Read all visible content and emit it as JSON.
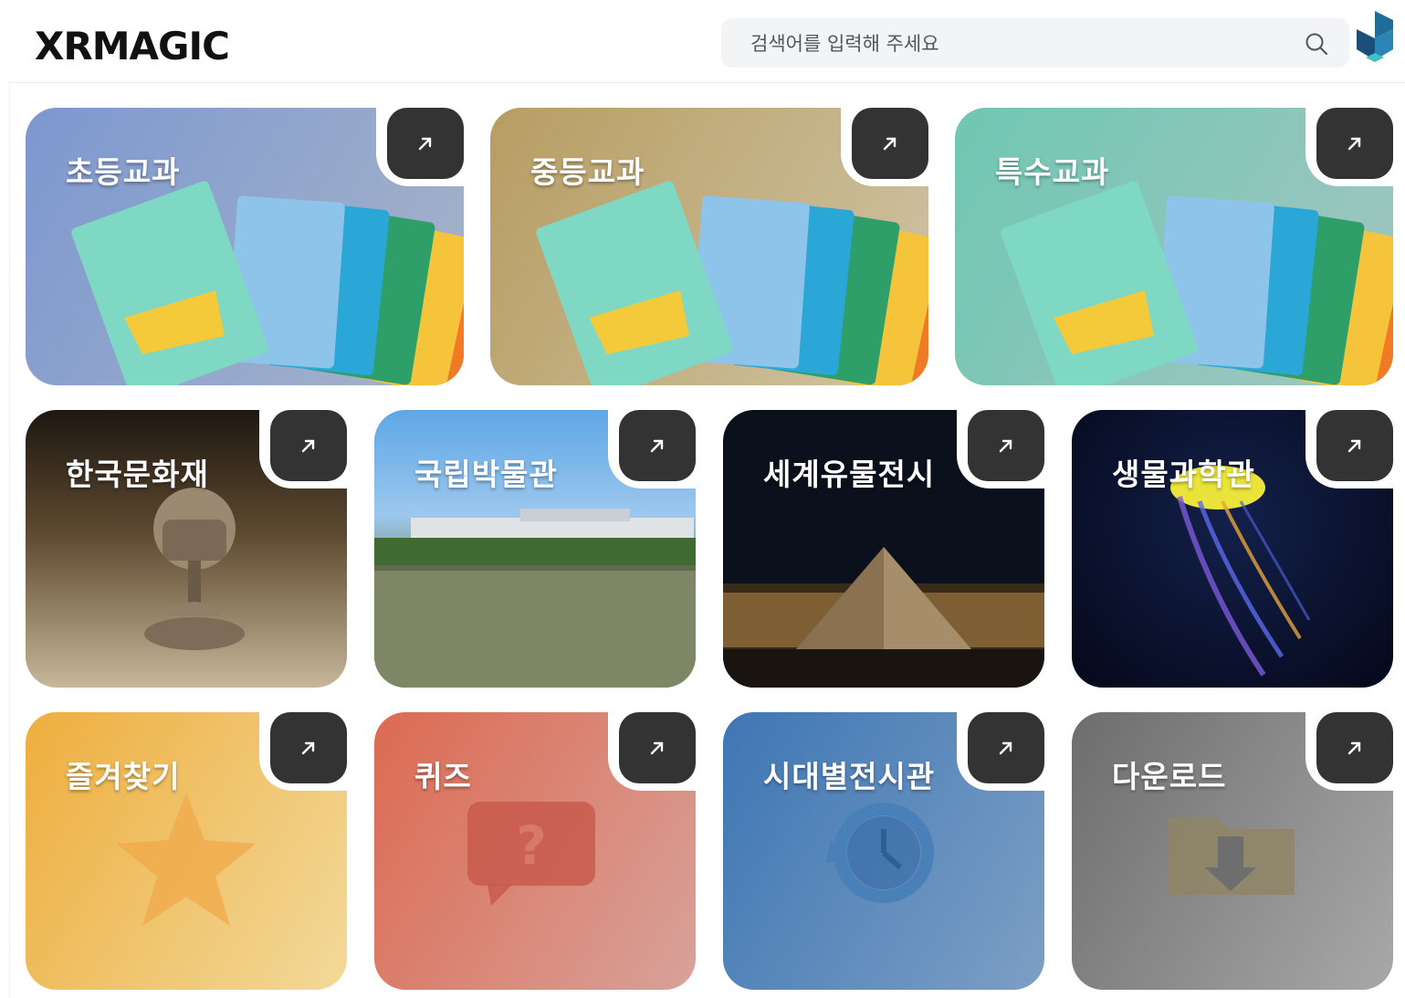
{
  "header": {
    "logo_text": "XRMAGIC",
    "search": {
      "placeholder": "검색어를 입력해 주세요"
    }
  },
  "cards": [
    {
      "title": "초등교과",
      "bg": "#8aa0c8",
      "illustration": "textbook-stack"
    },
    {
      "title": "중등교과",
      "bg": "#bba774",
      "illustration": "textbook-stack"
    },
    {
      "title": "특수교과",
      "bg": "#7fc6b8",
      "illustration": "textbook-stack"
    },
    {
      "title": "한국문화재",
      "bg": "#4a3a2a",
      "illustration": "incense-burner-photo"
    },
    {
      "title": "국립박물관",
      "bg": "#7fb6e8",
      "illustration": "museum-lake-photo"
    },
    {
      "title": "세계유물전시",
      "bg": "#0d1420",
      "illustration": "louvre-pyramid-photo"
    },
    {
      "title": "생물과학관",
      "bg": "#0a0f2a",
      "illustration": "jellyfish-photo"
    },
    {
      "title": "즐겨찾기",
      "bg": "#f0b84c",
      "illustration": "star-icon"
    },
    {
      "title": "퀴즈",
      "bg": "#d9705c",
      "illustration": "question-bubble-icon"
    },
    {
      "title": "시대별전시관",
      "bg": "#5a88bb",
      "illustration": "history-clock-icon"
    },
    {
      "title": "다운로드",
      "bg": "#8a8a8a",
      "illustration": "download-folder-icon"
    }
  ]
}
